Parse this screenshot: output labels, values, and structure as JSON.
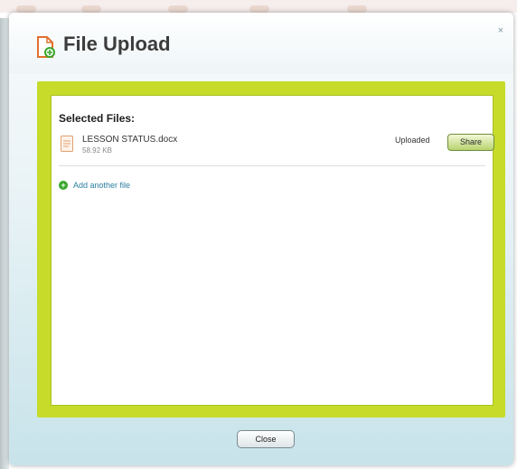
{
  "dialog": {
    "title": "File Upload",
    "close_symbol": "×",
    "section_title": "Selected Files:",
    "files": [
      {
        "name": "LESSON STATUS.docx",
        "size": "58.92 KB",
        "status": "Uploaded",
        "action_label": "Share"
      }
    ],
    "add_link": "Add another file",
    "add_icon_symbol": "+",
    "footer_button": "Close"
  },
  "colors": {
    "accent_green": "#c6db2a",
    "link_blue": "#2b7e9e",
    "plus_green": "#39a72b",
    "title_icon_orange": "#e0702c"
  },
  "icons": {
    "title": "file-upload-icon",
    "file": "document-icon",
    "add": "plus-circle-icon",
    "close": "close-icon"
  }
}
